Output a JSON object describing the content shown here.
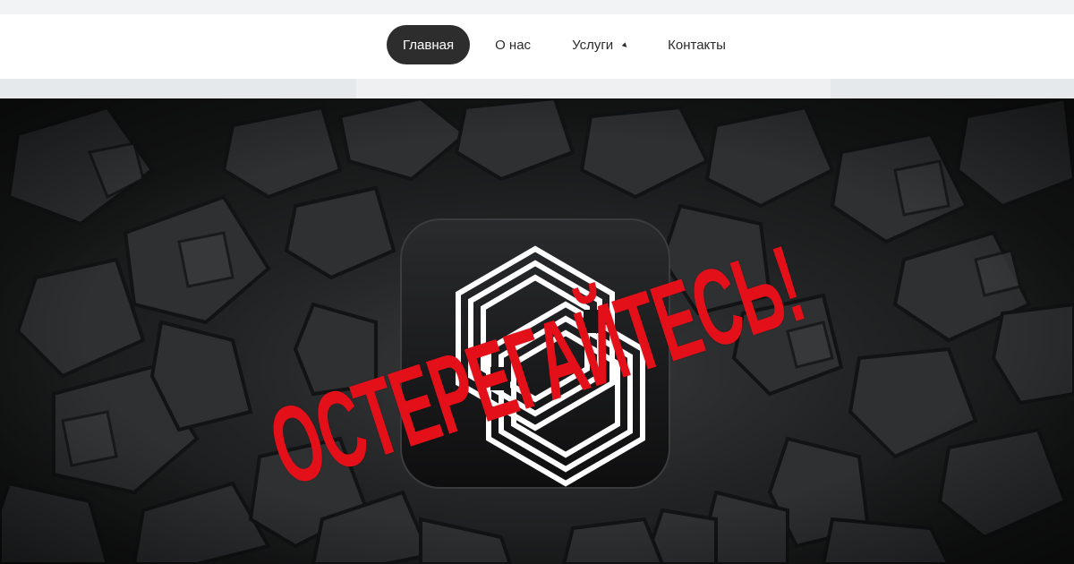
{
  "nav": {
    "items": [
      {
        "label": "Главная",
        "active": true
      },
      {
        "label": "О нас",
        "active": false
      },
      {
        "label": "Услуги",
        "active": false,
        "has_dropdown": true
      },
      {
        "label": "Контакты",
        "active": false
      }
    ],
    "dropdown_icon": "caret-down-icon"
  },
  "hero": {
    "warning_text": "ОСТЕРЕГАЙТЕСЬ!",
    "warning_color": "#e3101a",
    "logo_icon": "interlocked-hexagon-logo",
    "background": "dark-cracked-stone"
  },
  "colors": {
    "nav_active_bg": "#2d2d2d",
    "nav_bg": "#ffffff",
    "hero_bg": "#1b1c1d"
  }
}
